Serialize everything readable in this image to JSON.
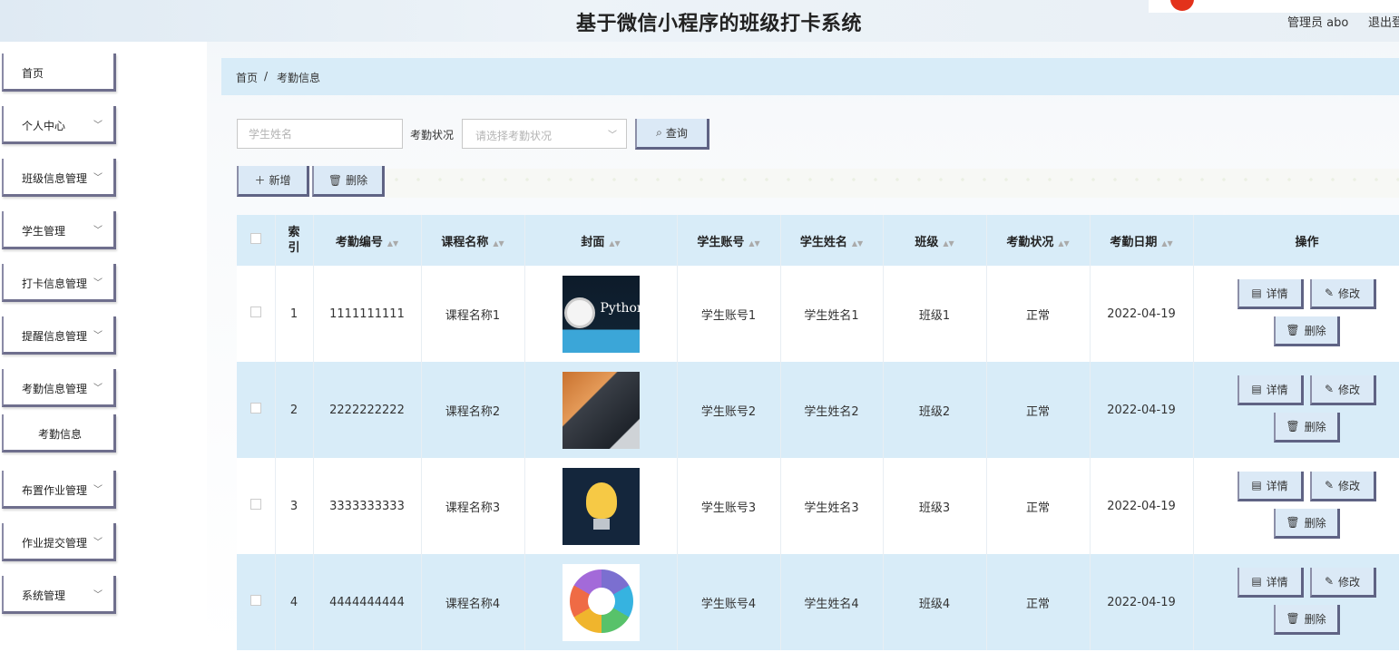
{
  "header": {
    "title": "基于微信小程序的班级打卡系统",
    "user_label": "管理员 abo",
    "logout_label": "退出登"
  },
  "sidebar": {
    "items": [
      {
        "label": "首页",
        "has_chevron": false
      },
      {
        "label": "个人中心",
        "has_chevron": true
      },
      {
        "label": "班级信息管理",
        "has_chevron": true
      },
      {
        "label": "学生管理",
        "has_chevron": true
      },
      {
        "label": "打卡信息管理",
        "has_chevron": true
      },
      {
        "label": "提醒信息管理",
        "has_chevron": true
      },
      {
        "label": "考勤信息管理",
        "has_chevron": true
      },
      {
        "label": "考勤信息",
        "sub": true
      },
      {
        "label": "布置作业管理",
        "has_chevron": true
      },
      {
        "label": "作业提交管理",
        "has_chevron": true
      },
      {
        "label": "系统管理",
        "has_chevron": true
      }
    ]
  },
  "breadcrumb": {
    "home": "首页",
    "separator": "/",
    "current": "考勤信息"
  },
  "search": {
    "name_placeholder": "学生姓名",
    "status_label": "考勤状况",
    "status_placeholder": "请选择考勤状况",
    "query_button": "查询"
  },
  "toolbar": {
    "add_button": "新增",
    "delete_button": "删除"
  },
  "table": {
    "columns": [
      "索引",
      "考勤编号",
      "课程名称",
      "封面",
      "学生账号",
      "学生姓名",
      "班级",
      "考勤状况",
      "考勤日期",
      "操作"
    ],
    "rows": [
      {
        "index": "1",
        "code": "1111111111",
        "course": "课程名称1",
        "cover": "python-cover",
        "account": "学生账号1",
        "name": "学生姓名1",
        "class": "班级1",
        "status": "正常",
        "date": "2022-04-19"
      },
      {
        "index": "2",
        "code": "2222222222",
        "course": "课程名称2",
        "cover": "laptop-cover",
        "account": "学生账号2",
        "name": "学生姓名2",
        "class": "班级2",
        "status": "正常",
        "date": "2022-04-19"
      },
      {
        "index": "3",
        "code": "3333333333",
        "course": "课程名称3",
        "cover": "lightbulb-cover",
        "account": "学生账号3",
        "name": "学生姓名3",
        "class": "班级3",
        "status": "正常",
        "date": "2022-04-19"
      },
      {
        "index": "4",
        "code": "4444444444",
        "course": "课程名称4",
        "cover": "tech-wheel-cover",
        "account": "学生账号4",
        "name": "学生姓名4",
        "class": "班级4",
        "status": "正常",
        "date": "2022-04-19"
      }
    ],
    "actions": {
      "detail": "详情",
      "edit": "修改",
      "delete": "删除"
    }
  },
  "colors": {
    "accent": "#d8ecf8",
    "button_bg": "#dbe9f6",
    "button_border": "#5f6384"
  }
}
